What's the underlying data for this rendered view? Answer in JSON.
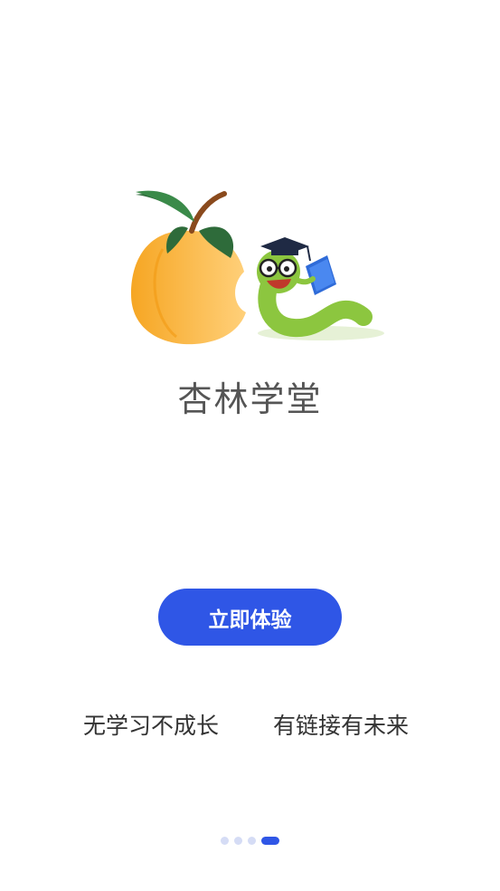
{
  "brand": {
    "name": "杏林学堂"
  },
  "cta": {
    "label": "立即体验"
  },
  "slogans": {
    "left": "无学习不成长",
    "right": "有链接有未来"
  },
  "pager": {
    "total": 4,
    "active_index": 3
  },
  "colors": {
    "accent": "#2f56e6",
    "pager_inactive": "#d5dcf5",
    "text_dark": "#333333",
    "brand_text": "#555555"
  },
  "icons": {
    "logo": "apricot-and-bookworm-logo"
  }
}
